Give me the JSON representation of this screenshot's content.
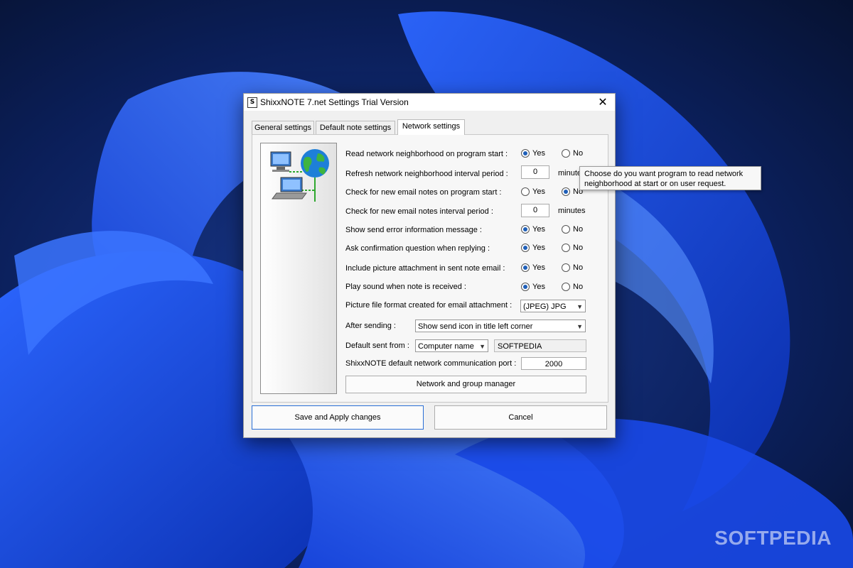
{
  "window": {
    "title": "ShixxNOTE 7.net Settings Trial Version",
    "app_icon_glyph": "S",
    "close_glyph": "✕"
  },
  "tabs": [
    {
      "label": "General settings",
      "active": false
    },
    {
      "label": "Default note settings",
      "active": false
    },
    {
      "label": "Network settings",
      "active": true
    }
  ],
  "settings": {
    "read_neighborhood": {
      "label": "Read network neighborhood on program start :",
      "yes": "Yes",
      "no": "No",
      "selected": "yes"
    },
    "refresh_interval": {
      "label": "Refresh network neighborhood interval period :",
      "value": "0",
      "unit": "minute"
    },
    "check_email": {
      "label": "Check for new email notes on program start :",
      "yes": "Yes",
      "no": "No",
      "selected": "no"
    },
    "check_email_interval": {
      "label": "Check for new email notes interval period :",
      "value": "0",
      "unit": "minutes"
    },
    "send_error": {
      "label": "Show send error information message :",
      "yes": "Yes",
      "no": "No",
      "selected": "yes"
    },
    "ask_confirm": {
      "label": "Ask confirmation question when replying :",
      "yes": "Yes",
      "no": "No",
      "selected": "yes"
    },
    "include_picture": {
      "label": "Include picture attachment in sent note email :",
      "yes": "Yes",
      "no": "No",
      "selected": "yes"
    },
    "play_sound": {
      "label": "Play sound when note is received :",
      "yes": "Yes",
      "no": "No",
      "selected": "yes"
    },
    "picture_format": {
      "label": "Picture file format created for email attachment :",
      "value": "(JPEG) JPG"
    },
    "after_sending": {
      "label": "After sending :",
      "value": "Show send icon in title left corner"
    },
    "default_sent_from": {
      "label": "Default sent from :",
      "value": "Computer name",
      "name_value": "SOFTPEDIA"
    },
    "port": {
      "label": "ShixxNOTE default network communication port :",
      "value": "2000"
    },
    "manager_button": "Network and group manager"
  },
  "buttons": {
    "save": "Save and Apply changes",
    "cancel": "Cancel"
  },
  "tooltip": {
    "line1": "Choose do you want program to read network",
    "line2": "neighborhood at start or on user request."
  },
  "watermark": "SOFTPEDIA",
  "colors": {
    "wallpaper_dark": "#0a1a4a",
    "wallpaper_blue": "#1d4fe6",
    "radio_selected": "#1f5fb8",
    "primary_border": "#2a6fd6"
  }
}
